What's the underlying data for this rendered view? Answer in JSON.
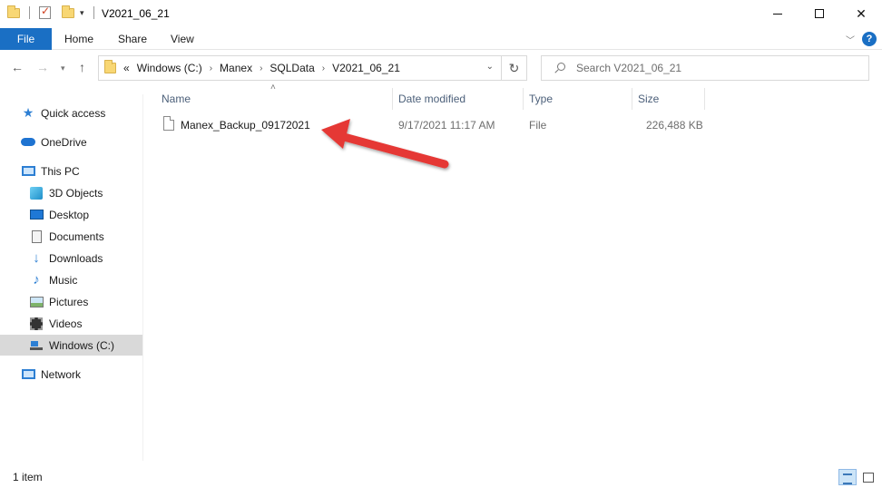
{
  "window": {
    "title": "V2021_06_21"
  },
  "ribbon": {
    "tabs": [
      {
        "label": "File"
      },
      {
        "label": "Home"
      },
      {
        "label": "Share"
      },
      {
        "label": "View"
      }
    ],
    "help_label": "?"
  },
  "address": {
    "overflow": "«",
    "crumbs": [
      "Windows (C:)",
      "Manex",
      "SQLData",
      "V2021_06_21"
    ]
  },
  "search": {
    "placeholder": "Search V2021_06_21"
  },
  "sidebar": {
    "items": [
      {
        "label": "Quick access",
        "icon": "star-icon"
      },
      {
        "label": "OneDrive",
        "icon": "cloud-icon"
      },
      {
        "label": "This PC",
        "icon": "computer-icon"
      },
      {
        "label": "3D Objects",
        "icon": "cube-icon"
      },
      {
        "label": "Desktop",
        "icon": "desktop-icon"
      },
      {
        "label": "Documents",
        "icon": "document-icon"
      },
      {
        "label": "Downloads",
        "icon": "download-icon"
      },
      {
        "label": "Music",
        "icon": "music-icon"
      },
      {
        "label": "Pictures",
        "icon": "pictures-icon"
      },
      {
        "label": "Videos",
        "icon": "video-icon"
      },
      {
        "label": "Windows (C:)",
        "icon": "drive-icon",
        "selected": true
      },
      {
        "label": "Network",
        "icon": "network-icon"
      }
    ]
  },
  "columns": {
    "name": "Name",
    "date": "Date modified",
    "type": "Type",
    "size": "Size"
  },
  "files": [
    {
      "name": "Manex_Backup_09172021",
      "date": "9/17/2021 11:17 AM",
      "type": "File",
      "size": "226,488 KB"
    }
  ],
  "status": {
    "count": "1 item"
  },
  "colors": {
    "accent": "#1a6fc4",
    "annotation_arrow": "#e53935"
  }
}
